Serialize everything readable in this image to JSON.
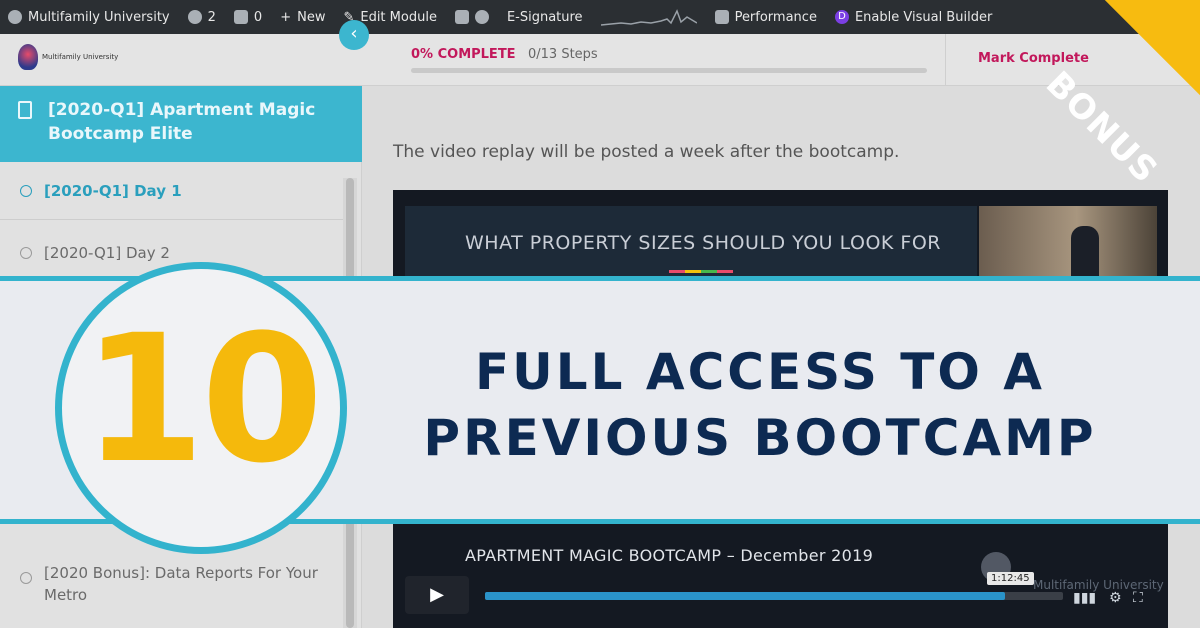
{
  "admin_bar": {
    "site_name": "Multifamily University",
    "updates_count": "2",
    "comments_count": "0",
    "new_label": "New",
    "edit_module_label": "Edit Module",
    "esignature_label": "E-Signature",
    "performance_label": "Performance",
    "visual_builder_label": "Enable Visual Builder"
  },
  "header": {
    "logo_text": "Multifamily University",
    "progress_label": "0% COMPLETE",
    "progress_value": 0,
    "steps_label": "0/13 Steps",
    "mark_complete_label": "Mark Complete"
  },
  "sidebar": {
    "course_title": "[2020-Q1] Apartment Magic Bootcamp Elite",
    "lessons": [
      {
        "label": "[2020-Q1] Day 1",
        "active": true
      },
      {
        "label": "[2020-Q1] Day 2",
        "active": false
      },
      {
        "label": "[2020 Bonus]: Data Reports For Your Metro",
        "active": false
      }
    ]
  },
  "main": {
    "intro_text": "The video replay will be posted a week after the bootcamp.",
    "video": {
      "slide_title": "WHAT PROPERTY SIZES SHOULD YOU LOOK FOR",
      "title": "APARTMENT MAGIC BOOTCAMP – December 2019",
      "timestamp": "1:12:45",
      "watermark": "Multifamily University",
      "progress_fraction": 0.9
    }
  },
  "overlay": {
    "number": "10",
    "headline_line1": "FULL ACCESS TO A",
    "headline_line2": "PREVIOUS BOOTCAMP",
    "ribbon": "BONUS"
  },
  "colors": {
    "accent": "#33b3cd",
    "headline": "#0d2a52",
    "number": "#f5b90c",
    "ribbon": "#f7bb10",
    "progress_text": "#c2185b"
  }
}
